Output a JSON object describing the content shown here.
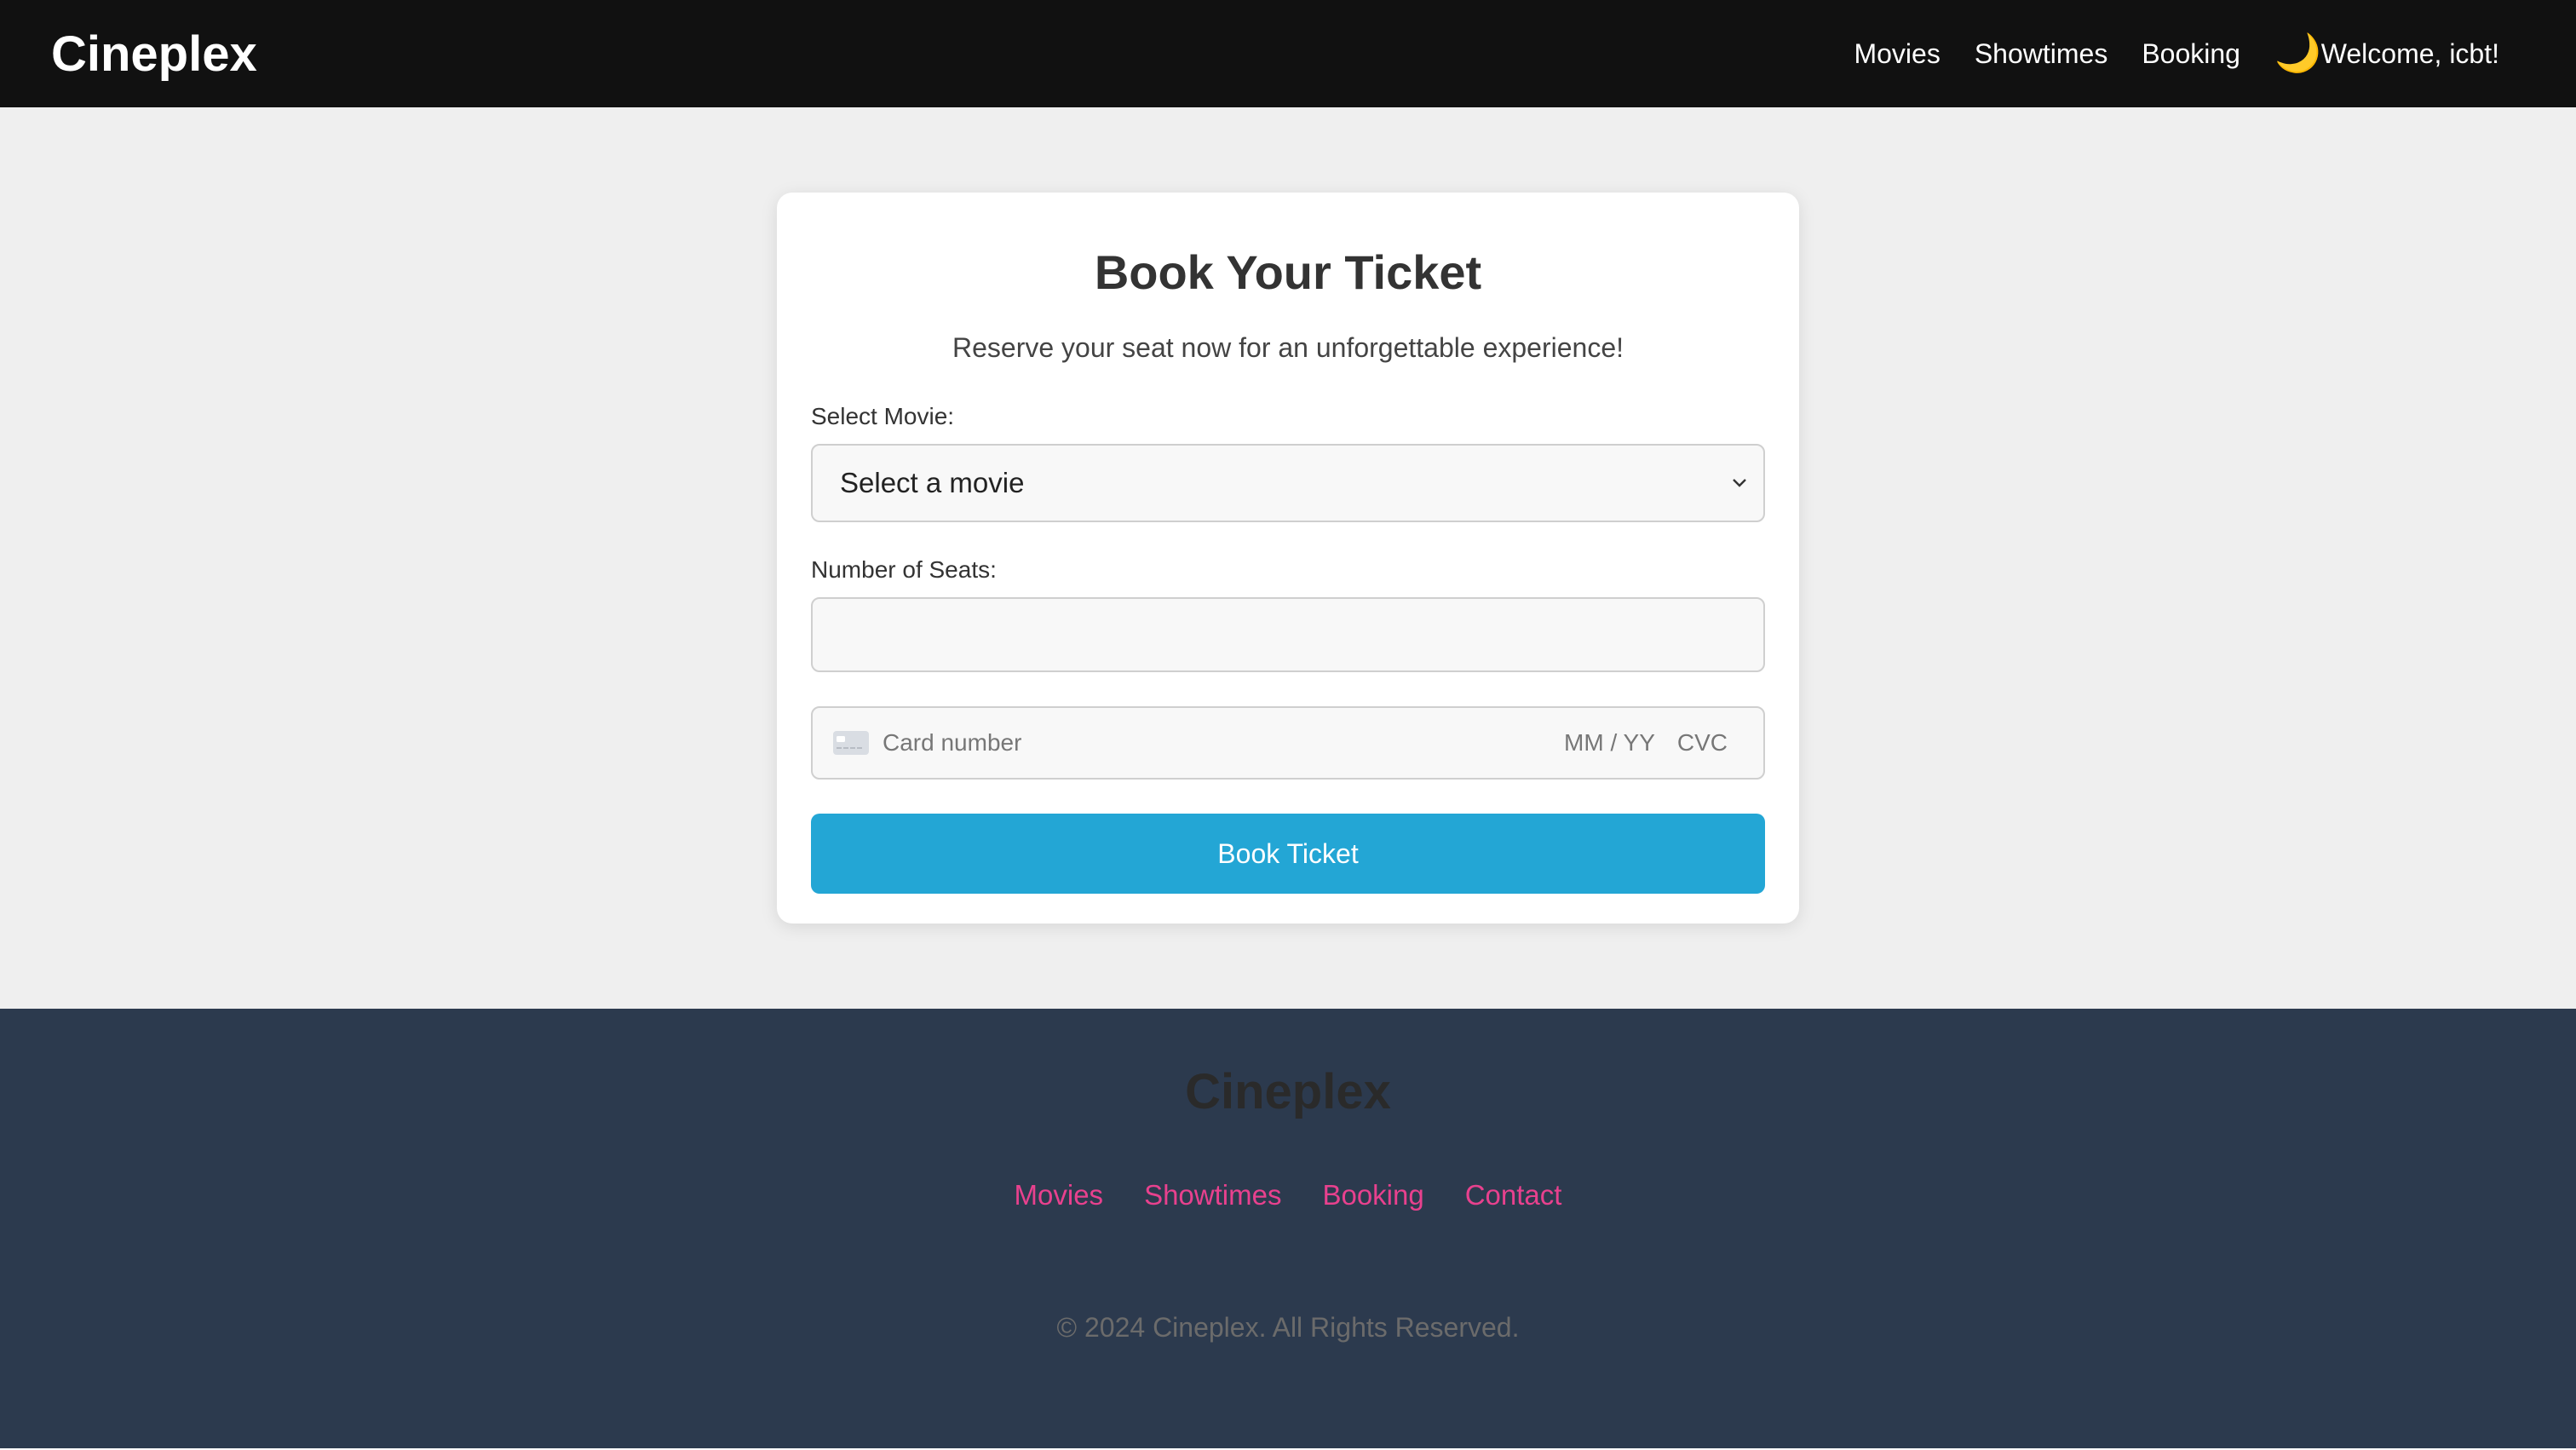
{
  "header": {
    "brand": "Cineplex",
    "nav": [
      "Movies",
      "Showtimes",
      "Booking"
    ],
    "theme_icon": "moon-icon",
    "welcome": "Welcome, icbt!"
  },
  "booking_card": {
    "title": "Book Your Ticket",
    "subtitle": "Reserve your seat now for an unforgettable experience!",
    "movie_label": "Select Movie:",
    "movie_selected": "Select a movie",
    "seats_label": "Number of Seats:",
    "seats_value": "",
    "payment": {
      "card_placeholder": "Card number",
      "expiry_placeholder": "MM / YY",
      "cvc_placeholder": "CVC"
    },
    "submit_label": "Book Ticket",
    "accent_color": "#23a6d5"
  },
  "footer": {
    "brand": "Cineplex",
    "links": [
      "Movies",
      "Showtimes",
      "Booking",
      "Contact"
    ],
    "copyright": "© 2024 Cineplex. All Rights Reserved.",
    "link_color": "#e8418e",
    "background_color": "#2c3a4e"
  }
}
